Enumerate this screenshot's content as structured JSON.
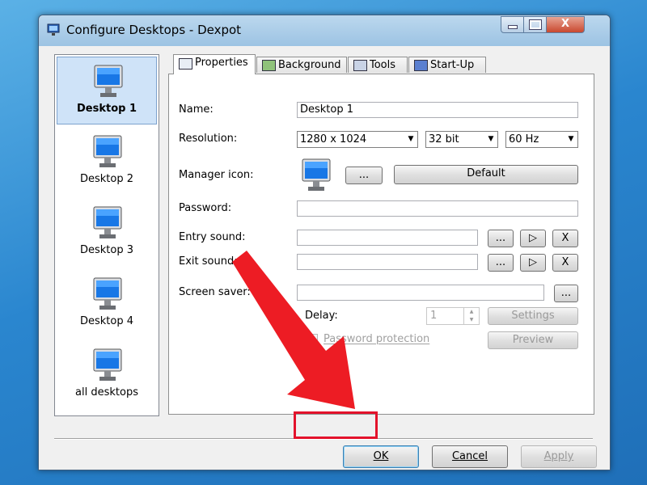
{
  "window": {
    "title": "Configure Desktops - Dexpot",
    "close_glyph": "X"
  },
  "desktops": [
    {
      "label": "Desktop 1",
      "selected": true
    },
    {
      "label": "Desktop 2",
      "selected": false
    },
    {
      "label": "Desktop 3",
      "selected": false
    },
    {
      "label": "Desktop 4",
      "selected": false
    },
    {
      "label": "all desktops",
      "selected": false
    }
  ],
  "tabs": [
    {
      "label": "Properties",
      "active": true
    },
    {
      "label": "Background",
      "active": false
    },
    {
      "label": "Tools",
      "active": false
    },
    {
      "label": "Start-Up",
      "active": false
    }
  ],
  "properties": {
    "name_label": "Name:",
    "name_value": "Desktop 1",
    "resolution_label": "Resolution:",
    "resolution_value": "1280 x 1024",
    "depth_value": "32 bit",
    "refresh_value": "60 Hz",
    "manager_icon_label": "Manager icon:",
    "browse_label": "...",
    "default_label": "Default",
    "password_label": "Password:",
    "password_value": "",
    "entry_sound_label": "Entry sound:",
    "entry_sound_value": "",
    "exit_sound_label": "Exit sound:",
    "exit_sound_value": "",
    "play_glyph": "▷",
    "clear_glyph": "X",
    "screensaver_label": "Screen saver:",
    "screensaver_value": "",
    "delay_label": "Delay:",
    "delay_value": "1",
    "settings_label": "Settings",
    "password_protection_label": "Password protection",
    "preview_label": "Preview"
  },
  "footer": {
    "ok_label": "OK",
    "cancel_label": "Cancel",
    "apply_label": "Apply"
  },
  "colors": {
    "highlight_red": "#e3122b",
    "selection_blue": "#cfe3f8"
  }
}
